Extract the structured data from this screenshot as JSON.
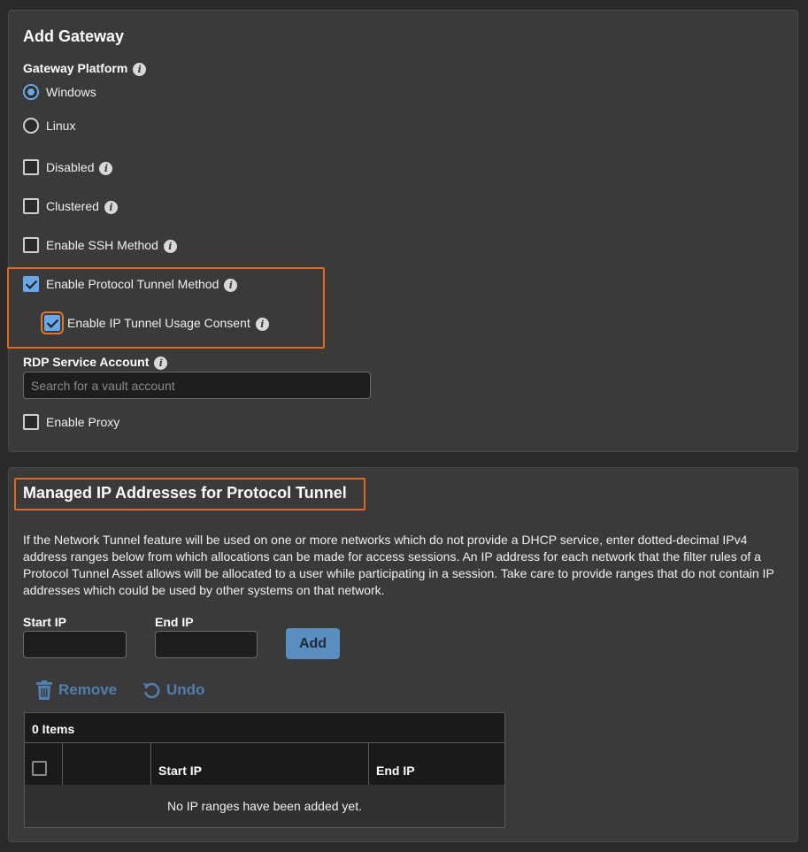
{
  "gateway": {
    "title": "Add Gateway",
    "platform_label": "Gateway Platform",
    "platform_options": [
      {
        "label": "Windows",
        "selected": true
      },
      {
        "label": "Linux",
        "selected": false
      }
    ],
    "checkboxes": {
      "disabled": {
        "label": "Disabled",
        "checked": false
      },
      "clustered": {
        "label": "Clustered",
        "checked": false
      },
      "ssh": {
        "label": "Enable SSH Method",
        "checked": false
      },
      "protocol_tunnel": {
        "label": "Enable Protocol Tunnel Method",
        "checked": true
      },
      "ip_tunnel_consent": {
        "label": "Enable IP Tunnel Usage Consent",
        "checked": true
      },
      "proxy": {
        "label": "Enable Proxy",
        "checked": false
      }
    },
    "rdp_label": "RDP Service Account",
    "rdp_placeholder": "Search for a vault account"
  },
  "managed_ip": {
    "title": "Managed IP Addresses for Protocol Tunnel",
    "description": "If the Network Tunnel feature will be used on one or more networks which do not provide a DHCP service, enter dotted-decimal IPv4 address ranges below from which allocations can be made for access sessions. An IP address for each network that the filter rules of a Protocol Tunnel Asset allows will be allocated to a user while participating in a session. Take care to provide ranges that do not contain IP addresses which could be used by other systems on that network.",
    "start_ip_label": "Start IP",
    "end_ip_label": "End IP",
    "add_label": "Add",
    "remove_label": "Remove",
    "undo_label": "Undo",
    "table": {
      "count_label": "0 Items",
      "columns": [
        "Start IP",
        "End IP"
      ],
      "empty_message": "No IP ranges have been added yet."
    }
  },
  "icons": {
    "info": "info-icon",
    "trash": "trash-icon",
    "undo": "undo-icon"
  },
  "colors": {
    "accent": "#6aa7e6",
    "highlight": "#e8651d",
    "button": "#5a8ec2"
  }
}
